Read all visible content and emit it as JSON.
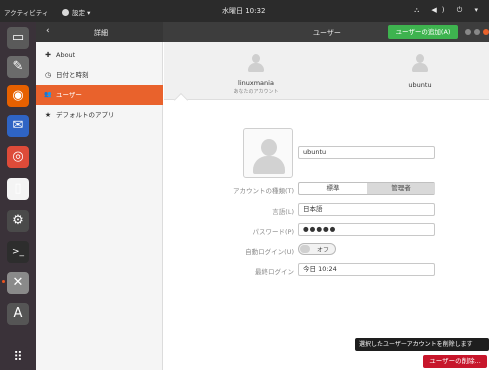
{
  "topbar": {
    "activities": "アクティビティ",
    "app_menu": "設定 ▾",
    "clock": "水曜日 10:32",
    "tray": "⛬ ◀) ⏻ ▾"
  },
  "dock": {
    "items": [
      {
        "icon": "files-icon",
        "glyph": "▭",
        "color": "#5a5a5a"
      },
      {
        "icon": "text-editor-icon",
        "glyph": "✎",
        "color": "#6b6b6b"
      },
      {
        "icon": "firefox-icon",
        "glyph": "◉",
        "color": "#e66000"
      },
      {
        "icon": "thunderbird-icon",
        "glyph": "✉",
        "color": "#2f64c4"
      },
      {
        "icon": "chrome-icon",
        "glyph": "◎",
        "color": "#dd4b39"
      },
      {
        "icon": "document-icon",
        "glyph": "▯",
        "color": "#f4f4f4"
      },
      {
        "icon": "settings-gear-icon",
        "glyph": "⚙",
        "color": "#4a4a4a"
      },
      {
        "icon": "terminal-icon",
        "glyph": ">_",
        "color": "#2d2d2d"
      },
      {
        "icon": "system-settings-icon",
        "glyph": "✕",
        "color": "#8a8a8a"
      },
      {
        "icon": "software-updater-icon",
        "glyph": "A",
        "color": "#555555"
      },
      {
        "icon": "app-grid-icon",
        "glyph": "⠿",
        "color": "#3a3239"
      }
    ]
  },
  "header": {
    "back_glyph": "‹",
    "left_title": "詳細",
    "right_title": "ユーザー",
    "add_user_label": "ユーザーの追加(A)"
  },
  "sidebar": {
    "items": [
      {
        "icon": "plus-icon",
        "glyph": "✚",
        "label": "About"
      },
      {
        "icon": "clock-icon",
        "glyph": "◷",
        "label": "日付と時刻"
      },
      {
        "icon": "users-icon",
        "glyph": "👥",
        "label": "ユーザー"
      },
      {
        "icon": "star-icon",
        "glyph": "★",
        "label": "デフォルトのアプリ"
      }
    ]
  },
  "users": {
    "list": [
      {
        "name": "linuxmania",
        "sub": "あなたのアカウント"
      },
      {
        "name": "ubuntu",
        "sub": ""
      }
    ]
  },
  "detail": {
    "full_name": "ubuntu",
    "account_type_label": "アカウントの種類(T)",
    "account_type_options": [
      "標準",
      "管理者"
    ],
    "language_label": "言語(L)",
    "language_value": "日本語",
    "password_label": "パスワード(P)",
    "password_value": "●●●●●",
    "auto_login_label": "自動ログイン(U)",
    "auto_login_value": "オフ",
    "last_login_label": "最終ログイン",
    "last_login_value": "今日 10:24"
  },
  "footer": {
    "tooltip": "選択したユーザーアカウントを削除します",
    "delete_label": "ユーザーの削除..."
  },
  "colors": {
    "accent": "#e9622c",
    "add_button": "#3eb34f",
    "delete_button": "#c7162b"
  }
}
